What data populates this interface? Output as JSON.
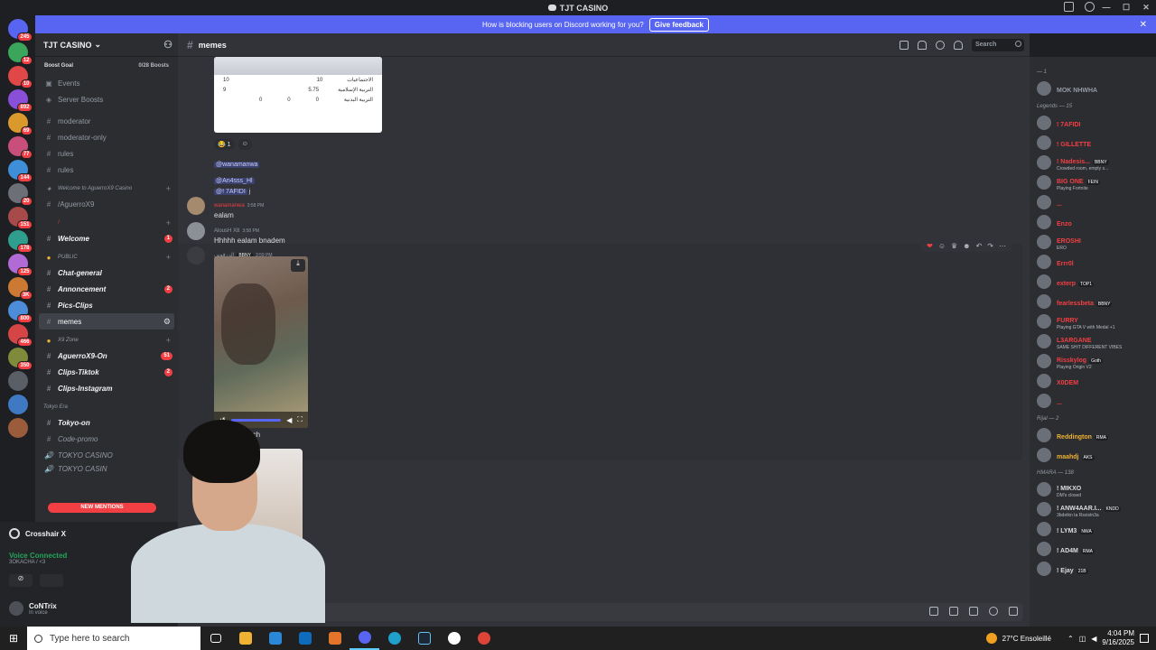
{
  "window": {
    "title": "TJT CASINO"
  },
  "banner": {
    "text": "How is blocking users on Discord working for you?",
    "button": "Give feedback"
  },
  "rail_badges": [
    "245",
    "12",
    "10",
    "892",
    "69",
    "77",
    "144",
    "20",
    "151",
    "178",
    "125",
    "3K",
    "800",
    "466",
    "350"
  ],
  "guild": {
    "name": "TJT CASINO",
    "boost_label": "Boost Goal",
    "boost_count": "0/28 Boosts"
  },
  "sidebar": {
    "items": [
      {
        "label": "Events",
        "icon": "calendar-icon"
      },
      {
        "label": "Server Boosts",
        "icon": "boost-icon"
      },
      {
        "label": "moderator",
        "icon": "hash-icon"
      },
      {
        "label": "moderator-only",
        "icon": "hash-icon"
      },
      {
        "label": "rules",
        "icon": "hash-icon"
      },
      {
        "label": "rules",
        "icon": "hash-icon"
      }
    ],
    "cat_welcome": "Welcome to AguerroX9 Casino",
    "aguerro": "/AguerroX9",
    "cat_bang": "!",
    "welcome": "Welcome",
    "welcome_count": "1",
    "cat_public": "PUBLIC",
    "chat_general": "Chat-general",
    "annoncement": "Annoncement",
    "annoncement_count": "2",
    "pics_clips": "Pics-Clips",
    "memes": "memes",
    "cat_x9": "X9 Zone",
    "aguerro_on": "AguerroX9-On",
    "aguerro_on_count": "51",
    "clips_tiktok": "Clips-Tiktok",
    "clips_tiktok_count": "2",
    "clips_instagram": "Clips-Instagram",
    "cat_tokyo": "Tokyo Era",
    "tokyo_on": "Tokyo-on",
    "code_promo": "Code-promo",
    "tokyo_casino": "TOKYO CASINO",
    "tokyo_casino2": "TOKYO CASIN",
    "new_mentions": "NEW MENTIONS"
  },
  "voice": {
    "app": "Crosshair X",
    "status": "Voice Connected",
    "channel": "3OKACHA / <3",
    "user": "CoNTrix",
    "user_status": "In voice"
  },
  "channel": {
    "name": "memes",
    "search_placeholder": "Search"
  },
  "table": {
    "rows": [
      {
        "a": "10",
        "b": "10",
        "label": "الاجتماعيات"
      },
      {
        "a": "9",
        "b": "5.75",
        "label": "التربية الإسلامية"
      },
      {
        "a": "0",
        "b": "0",
        "c": "0",
        "label": "التربية البدنية"
      }
    ]
  },
  "reactions": [
    {
      "emoji": "😂",
      "count": "1"
    },
    {
      "emoji": "☺",
      "count": ""
    }
  ],
  "mentions": [
    "@wanamanwa",
    "@An4sss_Hl",
    "@! 7AFIDI"
  ],
  "mention_suffix": "j",
  "messages": [
    {
      "name": "wanamanwa",
      "time": "3:58 PM",
      "text": "ealam"
    },
    {
      "name": "AlousH X8",
      "time": "3:58 PM",
      "text": "Hhhhh ealam bnadem"
    },
    {
      "name": "الزرقوني",
      "time": "3:59 PM",
      "tag": "BBNY",
      "text": ""
    }
  ],
  "video_caption": "Techtoch",
  "members": {
    "cat_top": "— 1",
    "top_user": "MOK NHWHA",
    "cat_legends": "Legends — 15",
    "legends": [
      {
        "name": "! 7AFIDI",
        "sub": ""
      },
      {
        "name": "! GILLETTE",
        "sub": ""
      },
      {
        "name": "! Nadesis...",
        "sub": "Crowded room, empty s...",
        "tag": "BBNY"
      },
      {
        "name": "BIG ONE",
        "sub": "Playing Fortnite",
        "tag": "FEIN"
      },
      {
        "name": "...",
        "sub": ""
      },
      {
        "name": "Enzo",
        "sub": ""
      },
      {
        "name": "EROSHI",
        "sub": "ERO"
      },
      {
        "name": "Errr0l",
        "sub": ""
      },
      {
        "name": "exterp",
        "sub": "",
        "tag": "TOP1"
      },
      {
        "name": "fearlessbeta",
        "sub": "",
        "tag": "BBNY"
      },
      {
        "name": "FURRY",
        "sub": "Playing GTA V with Medal +1"
      },
      {
        "name": "L3ARGANE",
        "sub": "SAME SHIT DIFFERENT VIBES"
      },
      {
        "name": "Risskylog",
        "sub": "Playing Origin V2",
        "tag": "Goth"
      },
      {
        "name": "X0DEM",
        "sub": ""
      },
      {
        "name": "...",
        "sub": ""
      }
    ],
    "cat_rijal": "Rijal — 2",
    "rijal": [
      {
        "name": "Reddington",
        "tag": "RMA"
      },
      {
        "name": "maahdj",
        "tag": "AKS"
      }
    ],
    "cat_hmara": "HMARA — 138",
    "hmara": [
      {
        "name": "! MIKXO",
        "sub": "DM's closed"
      },
      {
        "name": "! ANW4AAR.I...",
        "sub": "3bdetkn ta Rssistn3a",
        "tag": "KNDD"
      },
      {
        "name": "! LYM3",
        "sub": "",
        "tag": "NWA"
      },
      {
        "name": "! AD4M",
        "sub": "",
        "tag": "RMA"
      },
      {
        "name": "! Ejay",
        "sub": "",
        "tag": "21B"
      }
    ]
  },
  "taskbar": {
    "search_placeholder": "Type here to search",
    "weather": "27°C  Ensoleillé",
    "time": "4:04 PM",
    "date": "9/16/2025"
  }
}
